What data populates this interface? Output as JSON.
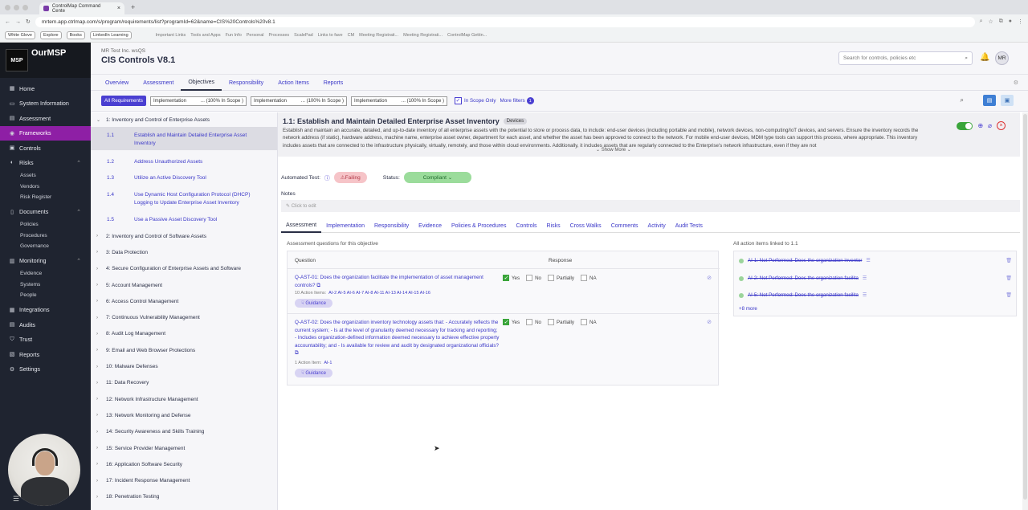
{
  "browser": {
    "tab_title": "ControlMap Command Cente",
    "url": "mrtem.app.ctrlmap.com/s/program/requirements/list?programId=62&name=CIS%20Controls%20v8.1",
    "bookmarks_pills": [
      "White Glove",
      "Explore",
      "Books",
      "LinkedIn Learning"
    ],
    "bookmarks": [
      "Important Links",
      "Tools and Apps",
      "Fun Info",
      "Personal",
      "Processes",
      "ScalePad",
      "Links to fave",
      "CM",
      "Meeting Registrati...",
      "Meeting Registrati...",
      "ControlMap Gettin..."
    ]
  },
  "brand": {
    "logo_text": "MSP",
    "name": "OurMSP"
  },
  "sidebar": {
    "items": [
      {
        "label": "Home",
        "icon": "grid-icon"
      },
      {
        "label": "System Information",
        "icon": "monitor-icon"
      },
      {
        "label": "Assessment",
        "icon": "clipboard-icon"
      },
      {
        "label": "Frameworks",
        "icon": "frameworks-icon",
        "active": true
      },
      {
        "label": "Controls",
        "icon": "controls-icon"
      },
      {
        "label": "Risks",
        "icon": "risk-icon",
        "children": [
          "Assets",
          "Vendors",
          "Risk Register"
        ]
      },
      {
        "label": "Documents",
        "icon": "document-icon",
        "children": [
          "Policies",
          "Procedures",
          "Governance"
        ]
      },
      {
        "label": "Monitoring",
        "icon": "monitoring-icon",
        "children": [
          "Evidence",
          "Systems",
          "People"
        ]
      },
      {
        "label": "Integrations",
        "icon": "integrations-icon"
      },
      {
        "label": "Audits",
        "icon": "audit-icon"
      },
      {
        "label": "Trust",
        "icon": "shield-icon"
      },
      {
        "label": "Reports",
        "icon": "report-icon"
      },
      {
        "label": "Settings",
        "icon": "gear-icon"
      }
    ]
  },
  "header": {
    "org": "MR Test Inc. wsQS",
    "title": "CIS Controls V8.1",
    "search_placeholder": "Search for controls, policies etc",
    "avatar": "MR"
  },
  "main_tabs": [
    "Overview",
    "Assessment",
    "Objectives",
    "Responsibility",
    "Action Items",
    "Reports"
  ],
  "active_main_tab": "Objectives",
  "filters": {
    "all": "All Requirements",
    "selects": [
      {
        "label": "Implementation",
        "value": "... (100% In Scope )"
      },
      {
        "label": "Implementation",
        "value": "... (100% In Scope )"
      },
      {
        "label": "Implementation",
        "value": "... (100% In Scope )"
      }
    ],
    "in_scope_only": "In Scope Only",
    "more_filters": "More filters",
    "more_count": "1"
  },
  "tree": [
    {
      "label": "1: Inventory and Control of Enterprise Assets",
      "expanded": true,
      "children": [
        {
          "num": "1.1",
          "label": "Establish and Maintain Detailed Enterprise Asset Inventory"
        },
        {
          "num": "1.2",
          "label": "Address Unauthorized Assets"
        },
        {
          "num": "1.3",
          "label": "Utilize an Active Discovery Tool"
        },
        {
          "num": "1.4",
          "label": "Use Dynamic Host Configuration Protocol (DHCP) Logging to Update Enterprise Asset Inventory"
        },
        {
          "num": "1.5",
          "label": "Use a Passive Asset Discovery Tool"
        }
      ]
    },
    {
      "label": "2: Inventory and Control of Software Assets"
    },
    {
      "label": "3: Data Protection"
    },
    {
      "label": "4: Secure Configuration of Enterprise Assets and Software"
    },
    {
      "label": "5: Account Management"
    },
    {
      "label": "6: Access Control Management"
    },
    {
      "label": "7: Continuous Vulnerability Management"
    },
    {
      "label": "8: Audit Log Management"
    },
    {
      "label": "9: Email and Web Browser Protections"
    },
    {
      "label": "10: Malware Defenses"
    },
    {
      "label": "11: Data Recovery"
    },
    {
      "label": "12: Network Infrastructure Management"
    },
    {
      "label": "13: Network Monitoring and Defense"
    },
    {
      "label": "14: Security Awareness and Skills Training"
    },
    {
      "label": "15: Service Provider Management"
    },
    {
      "label": "16: Application Software Security"
    },
    {
      "label": "17: Incident Response Management"
    },
    {
      "label": "18: Penetration Testing"
    }
  ],
  "requirement": {
    "title": "1.1: Establish and Maintain Detailed Enterprise Asset Inventory",
    "badge": "Devices",
    "description": "Establish and maintain an accurate, detailed, and up-to-date inventory of all enterprise assets with the potential to store or process data, to include: end-user devices (including portable and mobile), network devices, non-computing/IoT devices, and servers. Ensure the inventory records the network address (if static), hardware address, machine name, enterprise asset owner, department for each asset, and whether the asset has been approved to connect to the network. For mobile end-user devices, MDM type tools can support this process, where appropriate. This inventory includes assets that are connected to the infrastructure physically, virtually, remotely, and those within cloud environments. Additionally, it includes assets that are regularly connected to the Enterprise's network infrastructure, even if they are not",
    "show_more": "Show More",
    "automated_test_label": "Automated Test:",
    "automated_test_value": "Failing",
    "status_label": "Status:",
    "status_value": "Compliant",
    "notes_label": "Notes",
    "notes_placeholder": "Click to edit"
  },
  "content_tabs": [
    "Assessment",
    "Implementation",
    "Responsibility",
    "Evidence",
    "Policies & Procedures",
    "Controls",
    "Risks",
    "Cross Walks",
    "Comments",
    "Activity",
    "Audit Tests"
  ],
  "active_content_tab": "Assessment",
  "assessment": {
    "heading": "Assessment questions for this objective",
    "col_question": "Question",
    "col_response": "Response",
    "options": [
      "Yes",
      "No",
      "Partially",
      "NA"
    ],
    "guidance_label": "Guidance",
    "questions": [
      {
        "text": "Q-AST-01: Does the organization facilitate the implementation of asset management controls?",
        "action_label": "10 Action Items:",
        "actions": "AI-2  AI-5  AI-6  AI-7  AI-8  AI-11  AI-13  AI-14  AI-15  AI-16",
        "selected": "Yes"
      },
      {
        "text": "Q-AST-02: Does the organization inventory technology assets that: - Accurately reflects the current system; - Is at the level of granularity deemed necessary for tracking and reporting; - Includes organization-defined information deemed necessary to achieve effective property accountability; and - Is available for review and audit by designated organizational officials?",
        "action_label": "1 Action Item:",
        "actions": "AI-1",
        "selected": "Yes"
      }
    ]
  },
  "action_items": {
    "heading": "All action items linked to 1.1",
    "items": [
      "AI-1: Not Performed: Does the organization inventor",
      "AI-2: Not Performed: Does the organization facilita",
      "AI-5: Not Performed: Does the organization facilita"
    ],
    "more": "+8 more"
  }
}
